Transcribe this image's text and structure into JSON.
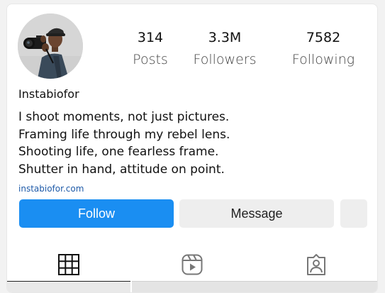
{
  "profile": {
    "username": "Instabiofor",
    "bio": [
      "I shoot moments, not just pictures.",
      "Framing life through my rebel lens.",
      "Shooting life, one fearless frame.",
      "Shutter in hand, attitude on point."
    ],
    "link": "instabiofor.com"
  },
  "stats": {
    "posts": {
      "value": "314",
      "label": "Posts"
    },
    "followers": {
      "value": "3.3M",
      "label": "Followers"
    },
    "following": {
      "value": "7582",
      "label": "Following"
    }
  },
  "actions": {
    "follow_label": "Follow",
    "message_label": "Message"
  },
  "tabs": [
    {
      "icon": "grid-icon",
      "active": true
    },
    {
      "icon": "reels-icon",
      "active": false
    },
    {
      "icon": "tagged-icon",
      "active": false
    }
  ],
  "colors": {
    "follow_button": "#1a8ef2",
    "secondary_button": "#eeeeee",
    "link": "#1e5aa8"
  }
}
